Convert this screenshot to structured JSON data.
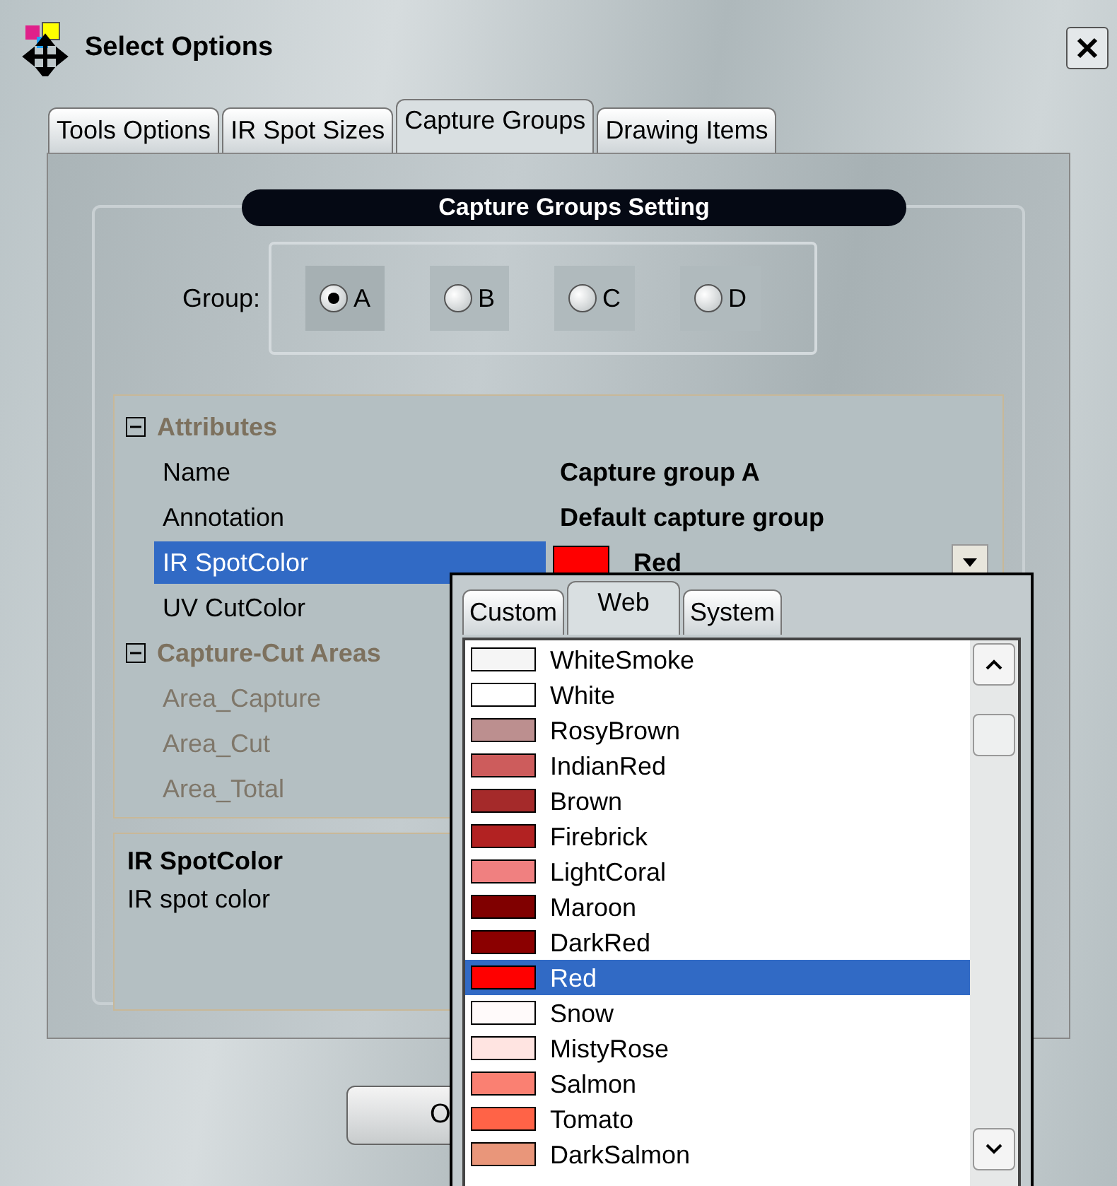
{
  "window": {
    "title": "Select Options"
  },
  "tabs": [
    {
      "label": "Tools Options",
      "selected": false
    },
    {
      "label": "IR Spot Sizes",
      "selected": false
    },
    {
      "label": "Capture Groups",
      "selected": true
    },
    {
      "label": "Drawing Items",
      "selected": false
    }
  ],
  "section_title": "Capture Groups Setting",
  "group": {
    "label": "Group:",
    "options": [
      {
        "label": "A",
        "selected": true
      },
      {
        "label": "B",
        "selected": false
      },
      {
        "label": "C",
        "selected": false
      },
      {
        "label": "D",
        "selected": false
      }
    ]
  },
  "properties": [
    {
      "kind": "category",
      "label": "Attributes",
      "expanded": true
    },
    {
      "kind": "property",
      "label": "Name",
      "value": "Capture group A",
      "selected": false,
      "disabled": false
    },
    {
      "kind": "property",
      "label": "Annotation",
      "value": "Default capture group",
      "selected": false,
      "disabled": false
    },
    {
      "kind": "color",
      "label": "IR SpotColor",
      "value": "Red",
      "color": "#ff0000",
      "selected": true,
      "disabled": false
    },
    {
      "kind": "property",
      "label": "UV CutColor",
      "selected": false,
      "disabled": false
    },
    {
      "kind": "category",
      "label": "Capture-Cut Areas",
      "expanded": true
    },
    {
      "kind": "property",
      "label": "Area_Capture",
      "selected": false,
      "disabled": true
    },
    {
      "kind": "property",
      "label": "Area_Cut",
      "selected": false,
      "disabled": true
    },
    {
      "kind": "property",
      "label": "Area_Total",
      "selected": false,
      "disabled": true
    }
  ],
  "description": {
    "title": "IR SpotColor",
    "text": "IR spot color"
  },
  "ok_button": {
    "label": "O"
  },
  "color_picker": {
    "tabs": [
      {
        "label": "Custom",
        "selected": false
      },
      {
        "label": "Web",
        "selected": true
      },
      {
        "label": "System",
        "selected": false
      }
    ],
    "colors": [
      {
        "name": "WhiteSmoke",
        "color": "#f5f5f5",
        "selected": false
      },
      {
        "name": "White",
        "color": "#ffffff",
        "selected": false
      },
      {
        "name": "RosyBrown",
        "color": "#bc8f8f",
        "selected": false
      },
      {
        "name": "IndianRed",
        "color": "#cd5c5c",
        "selected": false
      },
      {
        "name": "Brown",
        "color": "#a52a2a",
        "selected": false
      },
      {
        "name": "Firebrick",
        "color": "#b22222",
        "selected": false
      },
      {
        "name": "LightCoral",
        "color": "#f08080",
        "selected": false
      },
      {
        "name": "Maroon",
        "color": "#800000",
        "selected": false
      },
      {
        "name": "DarkRed",
        "color": "#8b0000",
        "selected": false
      },
      {
        "name": "Red",
        "color": "#ff0000",
        "selected": true
      },
      {
        "name": "Snow",
        "color": "#fffafa",
        "selected": false
      },
      {
        "name": "MistyRose",
        "color": "#ffe4e1",
        "selected": false
      },
      {
        "name": "Salmon",
        "color": "#fa8072",
        "selected": false
      },
      {
        "name": "Tomato",
        "color": "#ff6347",
        "selected": false
      },
      {
        "name": "DarkSalmon",
        "color": "#e9967a",
        "selected": false
      }
    ]
  }
}
